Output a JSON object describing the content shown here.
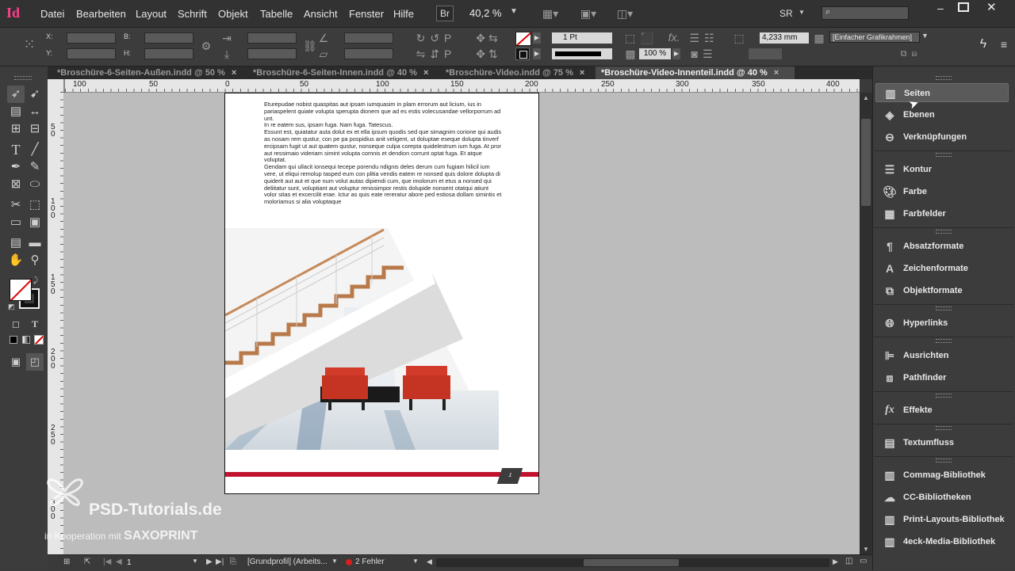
{
  "app": {
    "logo": "Id"
  },
  "menu": [
    "Datei",
    "Bearbeiten",
    "Layout",
    "Schrift",
    "Objekt",
    "Tabelle",
    "Ansicht",
    "Fenster",
    "Hilfe"
  ],
  "header": {
    "bridge": "Br",
    "zoom": "40,2 %",
    "workspace": "SR"
  },
  "control": {
    "x_label": "X:",
    "y_label": "Y:",
    "w_label": "B:",
    "h_label": "H:",
    "stroke_weight": "1 Pt",
    "offset": "4,233 mm",
    "frame_style": "[Einfacher Grafikrahmen]",
    "percent": "100 %"
  },
  "tabs": [
    {
      "label": "*Broschüre-6-Seiten-Außen.indd @ 50 %"
    },
    {
      "label": "*Broschüre-6-Seiten-Innen.indd @ 40 %"
    },
    {
      "label": "*Broschüre-Video.indd @ 75 %"
    },
    {
      "label": "*Broschüre-Video-Innenteil.indd @ 40 %",
      "active": true
    }
  ],
  "tab_close": "×",
  "ruler_h": [
    "100",
    "50",
    "0",
    "50",
    "100",
    "150",
    "200",
    "250",
    "300",
    "350",
    "400"
  ],
  "ruler_v": [
    "5",
    "0",
    "1",
    "0",
    "0",
    "1",
    "5",
    "0",
    "2",
    "0",
    "0",
    "2",
    "5",
    "0",
    "3",
    "0",
    "0"
  ],
  "document": {
    "body_text": "Eturepudae nobist quaspitas aut ipsam iumquasim in plam errorum aut licium, ius in pariaspelent quiate volupta sperupta dionem que ad es estis volecusandae vellorporrum ad unt.\nIn re eatem sus, ipsam fuga. Nam fuga. Tatescus.\nEssunt est, quiatatur auta dolut ex et ella ipsum quodis sed que simagnim corione qui audis as nosam rem qustur, con pe pa pospidius anit veligent, ut doluptae eseque dolupta tinverf ercipsam fugit ut aut quatem qustur, nonseque culpa corepta quidelestrum ium fuga. At pror aut ressimaio videriam simint volupta comnis et dendion corrunt optat fuga. Et atque voluptat.\nGendam qui ullacit ionsequi tecepe porendu ndignis deles derum cum fugiam hilicil ium vere, ut eliqui remolup tasped eum con plitia vendis eatem re nonsed quis dolore dolupta di quiderit aut aut et que num volut autas dipiendi cum, que imolorum et etus a nonsed qui deliitatur sunt, voluptiant aut voluptur renissimpor restis dolupide nonsent otatqui atiunt volor sitas et excercilit erae. Ictur as quis eate rereratur abore ped estiosa dollam simintis et moloriamus si alia voluptaque",
    "page_number": "1"
  },
  "status": {
    "page": "1",
    "profile": "[Grundprofil] (Arbeits...",
    "errors": "2 Fehler"
  },
  "panel": [
    {
      "label": "Seiten",
      "icon": "pages-icon",
      "active": true
    },
    {
      "label": "Ebenen",
      "icon": "layers-icon"
    },
    {
      "label": "Verknüpfungen",
      "icon": "links-icon"
    },
    {
      "label": "Kontur",
      "icon": "stroke-icon"
    },
    {
      "label": "Farbe",
      "icon": "color-icon"
    },
    {
      "label": "Farbfelder",
      "icon": "swatches-icon"
    },
    {
      "label": "Absatzformate",
      "icon": "paragraph-styles-icon"
    },
    {
      "label": "Zeichenformate",
      "icon": "character-styles-icon"
    },
    {
      "label": "Objektformate",
      "icon": "object-styles-icon"
    },
    {
      "label": "Hyperlinks",
      "icon": "hyperlinks-icon"
    },
    {
      "label": "Ausrichten",
      "icon": "align-icon"
    },
    {
      "label": "Pathfinder",
      "icon": "pathfinder-icon"
    },
    {
      "label": "Effekte",
      "icon": "effects-icon"
    },
    {
      "label": "Textumfluss",
      "icon": "text-wrap-icon"
    },
    {
      "label": "Commag-Bibliothek",
      "icon": "library-icon"
    },
    {
      "label": "CC-Bibliotheken",
      "icon": "cc-libraries-icon"
    },
    {
      "label": "Print-Layouts-Bibliothek",
      "icon": "library-icon"
    },
    {
      "label": "4eck-Media-Bibliothek",
      "icon": "library-icon"
    }
  ],
  "watermark": {
    "brand": "PSD-Tutorials.de",
    "sub_prefix": "in Kooperation mit",
    "sub_brand": "SAXOPRINT"
  },
  "colors": {
    "accent_red": "#c1122f",
    "indesign_pink": "#ff3d8b",
    "panel_bg": "#3c3c3c",
    "pasteboard": "#bcbcbc"
  }
}
